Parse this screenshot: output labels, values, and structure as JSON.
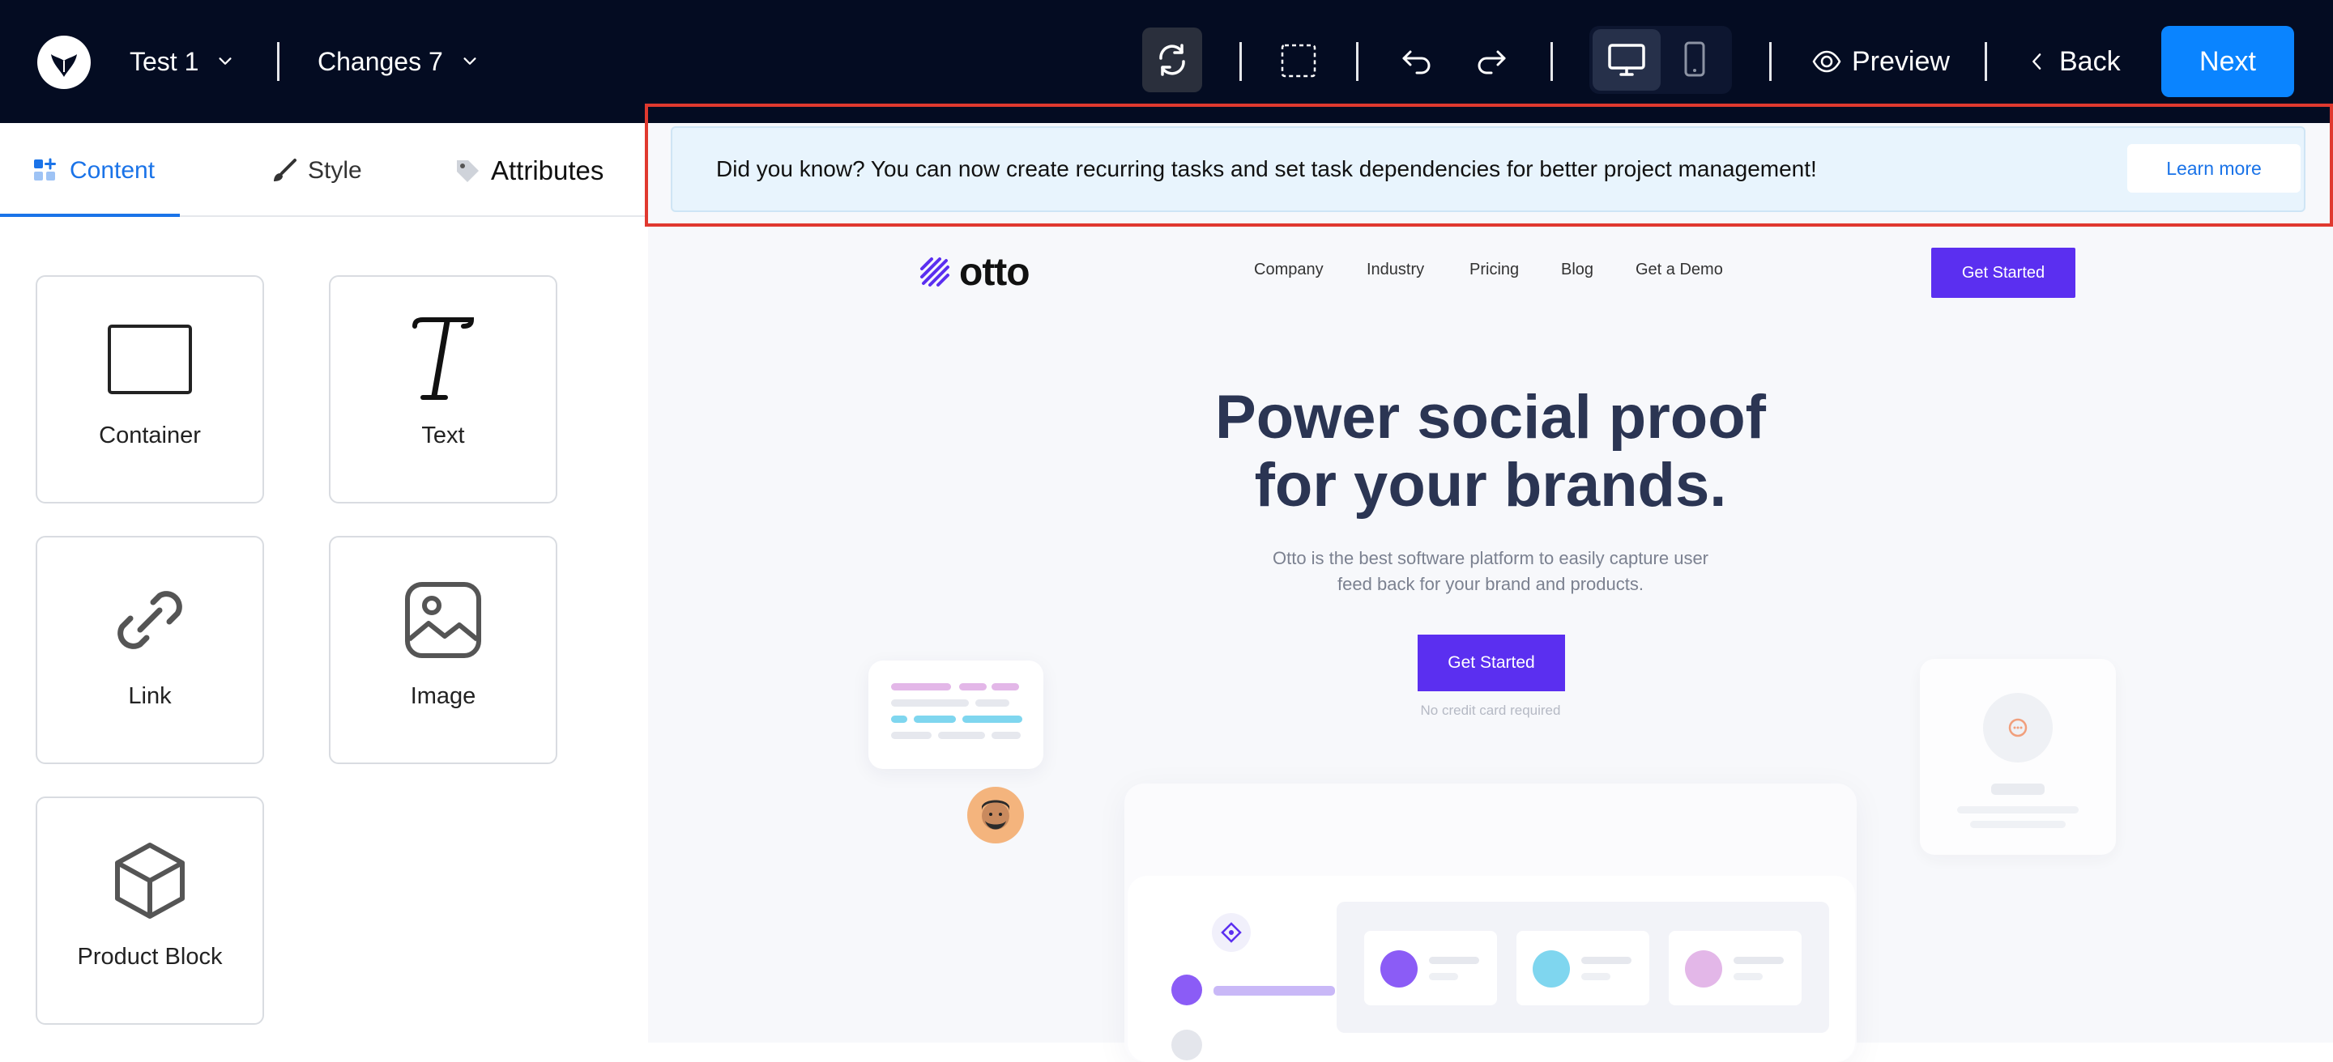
{
  "toolbar": {
    "project_name": "Test 1",
    "changes_label": "Changes 7",
    "preview_label": "Preview",
    "back_label": "Back",
    "next_label": "Next",
    "icons": [
      "logo-icon",
      "refresh-icon",
      "select-area-icon",
      "undo-icon",
      "redo-icon",
      "desktop-icon",
      "mobile-icon",
      "eye-icon",
      "chevron-left-icon"
    ],
    "accent_color": "#0a84ff"
  },
  "sidebar": {
    "tabs": [
      {
        "label": "Content",
        "active": true
      },
      {
        "label": "Style",
        "active": false
      },
      {
        "label": "Attributes",
        "active": false
      }
    ],
    "blocks": [
      {
        "label": "Container",
        "icon": "container-icon"
      },
      {
        "label": "Text",
        "icon": "text-icon"
      },
      {
        "label": "Link",
        "icon": "link-icon"
      },
      {
        "label": "Image",
        "icon": "image-icon"
      },
      {
        "label": "Product Block",
        "icon": "cube-icon"
      }
    ]
  },
  "banner": {
    "text": "Did you know? You can now create recurring tasks and set task dependencies for better project management!",
    "button_label": "Learn more",
    "outline_color": "#e0392f"
  },
  "site": {
    "logo_text": "otto",
    "nav": [
      "Company",
      "Industry",
      "Pricing",
      "Blog",
      "Get a Demo"
    ],
    "nav_cta": "Get Started",
    "hero_title_line1": "Power social proof",
    "hero_title_line2": "for your brands.",
    "hero_subtitle_line1": "Otto is the best software platform to easily capture user",
    "hero_subtitle_line2": "feed back for your brand and products.",
    "hero_cta": "Get Started",
    "hero_note": "No credit card required",
    "brand_color": "#5b2ff0"
  }
}
